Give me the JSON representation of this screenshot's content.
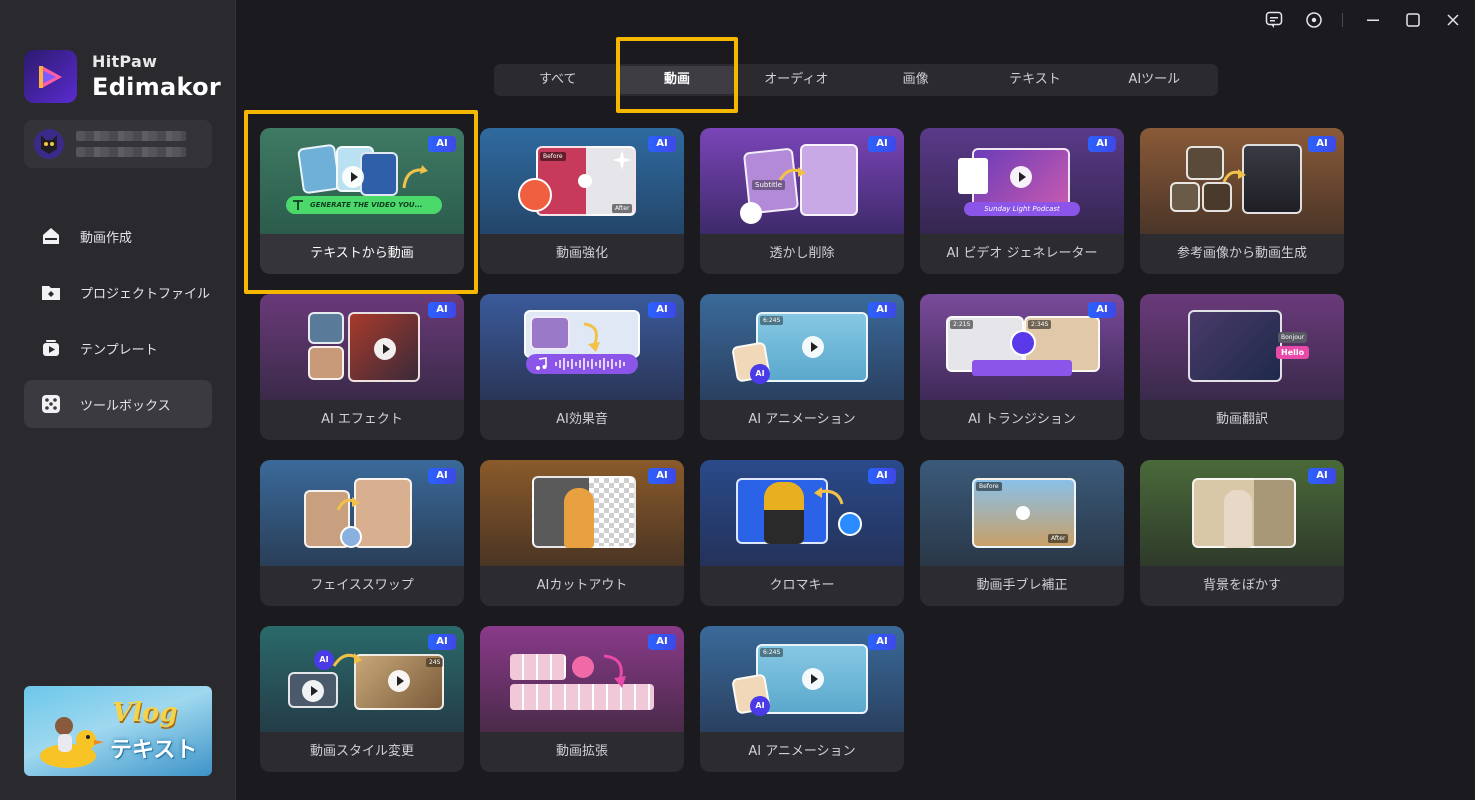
{
  "brand": {
    "name_small": "HitPaw",
    "name_big": "Edimakor"
  },
  "nav": [
    {
      "label": "動画作成",
      "icon": "home-icon",
      "active": false
    },
    {
      "label": "プロジェクトファイル",
      "icon": "project-folder-icon",
      "active": false
    },
    {
      "label": "テンプレート",
      "icon": "template-icon",
      "active": false
    },
    {
      "label": "ツールボックス",
      "icon": "toolbox-icon",
      "active": true
    }
  ],
  "promo": {
    "title": "Vlog",
    "subtitle": "テキスト"
  },
  "tabs": [
    {
      "label": "すべて",
      "active": false
    },
    {
      "label": "動画",
      "active": true
    },
    {
      "label": "オーディオ",
      "active": false
    },
    {
      "label": "画像",
      "active": false
    },
    {
      "label": "テキスト",
      "active": false
    },
    {
      "label": "AIツール",
      "active": false
    }
  ],
  "badge": "AI",
  "thumb_texts": {
    "t2v_prompt": "GENERATE THE VIDEO YOU...",
    "before": "Before",
    "after": "After",
    "subtitle": "Subtitle",
    "podcast": "Sunday Light Podcast",
    "bonjour": "Bonjour",
    "hello": "Hello",
    "anim_time": "6:24S",
    "trans_time1": "2:21S",
    "trans_time2": "2:34S",
    "style_time": "24S"
  },
  "tools": [
    {
      "label": "テキストから動画",
      "ai": true,
      "selected": true
    },
    {
      "label": "動画強化",
      "ai": true
    },
    {
      "label": "透かし削除",
      "ai": true
    },
    {
      "label": "AI ビデオ ジェネレーター",
      "ai": true
    },
    {
      "label": "参考画像から動画生成",
      "ai": true
    },
    {
      "label": "AI エフェクト",
      "ai": true
    },
    {
      "label": "AI効果音",
      "ai": true
    },
    {
      "label": "AI アニメーション",
      "ai": true
    },
    {
      "label": "AI トランジション",
      "ai": true
    },
    {
      "label": "動画翻訳",
      "ai": false
    },
    {
      "label": "フェイススワップ",
      "ai": true
    },
    {
      "label": "AIカットアウト",
      "ai": true
    },
    {
      "label": "クロマキー",
      "ai": true
    },
    {
      "label": "動画手ブレ補正",
      "ai": false
    },
    {
      "label": "背景をぼかす",
      "ai": true
    },
    {
      "label": "動画スタイル変更",
      "ai": true
    },
    {
      "label": "動画拡張",
      "ai": true
    },
    {
      "label": "AI アニメーション",
      "ai": true
    }
  ],
  "colors": {
    "highlight": "#f5b700",
    "ai_badge": "#2a62ff",
    "background": "#1b1b1f",
    "sidebar": "#29292e"
  }
}
